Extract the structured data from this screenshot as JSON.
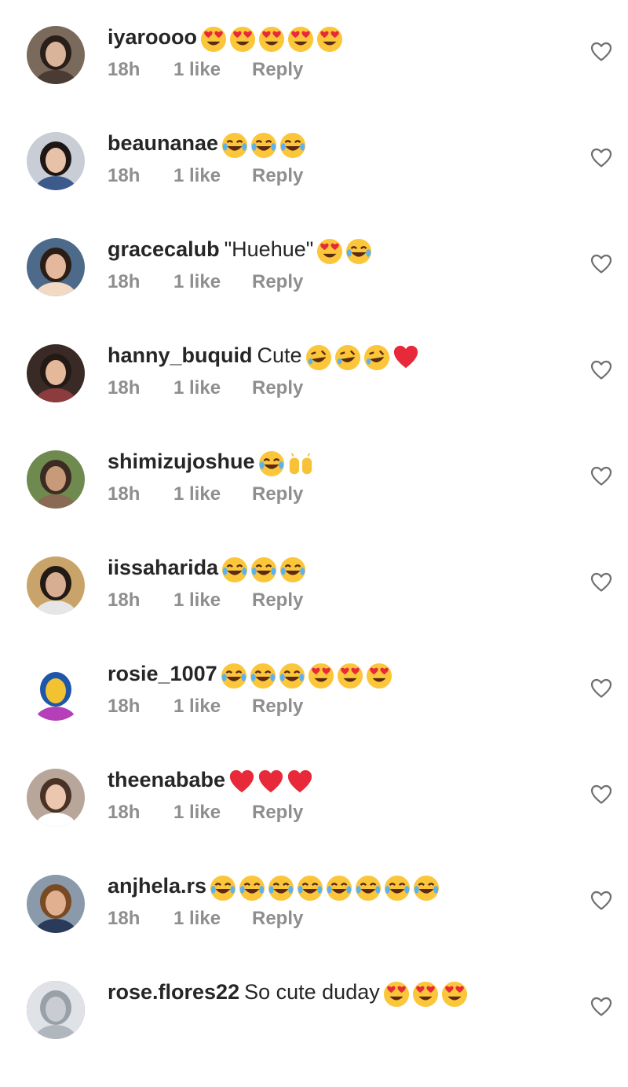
{
  "comments": [
    {
      "username": "iyaroooo",
      "text": "",
      "emojis": [
        "heart-eyes",
        "heart-eyes",
        "heart-eyes",
        "heart-eyes",
        "heart-eyes"
      ],
      "time": "18h",
      "likes": "1 like",
      "reply": "Reply",
      "avatar": {
        "bg": "#7a6a5c",
        "skin": "#d9b39a",
        "hair": "#2a1e19",
        "shirt": "#4a3b33"
      }
    },
    {
      "username": "beaunanae",
      "text": "",
      "emojis": [
        "joy",
        "joy",
        "joy"
      ],
      "time": "18h",
      "likes": "1 like",
      "reply": "Reply",
      "avatar": {
        "bg": "#c9cdd6",
        "skin": "#e8c2a8",
        "hair": "#1d1614",
        "shirt": "#3c5a8a"
      }
    },
    {
      "username": "gracecalub",
      "text": "\"Huehue\"",
      "emojis": [
        "heart-eyes",
        "joy"
      ],
      "time": "18h",
      "likes": "1 like",
      "reply": "Reply",
      "avatar": {
        "bg": "#4d6a8a",
        "skin": "#e3b89c",
        "hair": "#2b1d16",
        "shirt": "#f2d9c4"
      }
    },
    {
      "username": "hanny_buquid",
      "text": "Cute",
      "emojis": [
        "rofl",
        "rofl",
        "rofl",
        "red-heart"
      ],
      "time": "18h",
      "likes": "1 like",
      "reply": "Reply",
      "avatar": {
        "bg": "#3a2a26",
        "skin": "#e4b89a",
        "hair": "#231915",
        "shirt": "#8c3c3c"
      }
    },
    {
      "username": "shimizujoshue",
      "text": "",
      "emojis": [
        "joy",
        "raised-hands"
      ],
      "time": "18h",
      "likes": "1 like",
      "reply": "Reply",
      "avatar": {
        "bg": "#6e8a4e",
        "skin": "#c79a7a",
        "hair": "#3b2b22",
        "shirt": "#8a6a52"
      }
    },
    {
      "username": "iissaharida",
      "text": "",
      "emojis": [
        "joy",
        "joy",
        "joy"
      ],
      "time": "18h",
      "likes": "1 like",
      "reply": "Reply",
      "avatar": {
        "bg": "#c8a46a",
        "skin": "#d8ae92",
        "hair": "#231a15",
        "shirt": "#e6e6e6"
      }
    },
    {
      "username": "rosie_1007",
      "text": "",
      "emojis": [
        "joy",
        "joy",
        "joy",
        "heart-eyes",
        "heart-eyes",
        "heart-eyes"
      ],
      "time": "18h",
      "likes": "1 like",
      "reply": "Reply",
      "avatar": {
        "bg": "#ffffff",
        "skin": "#f2c230",
        "hair": "#1e56a8",
        "shirt": "#b43fb8"
      }
    },
    {
      "username": "theenababe",
      "text": "",
      "emojis": [
        "red-heart",
        "red-heart",
        "red-heart"
      ],
      "time": "18h",
      "likes": "1 like",
      "reply": "Reply",
      "avatar": {
        "bg": "#b9a69a",
        "skin": "#ecc7b0",
        "hair": "#4a3226",
        "shirt": "#ffffff"
      }
    },
    {
      "username": "anjhela.rs",
      "text": "",
      "emojis": [
        "joy",
        "joy",
        "joy",
        "joy",
        "joy",
        "joy",
        "joy",
        "joy"
      ],
      "time": "18h",
      "likes": "1 like",
      "reply": "Reply",
      "avatar": {
        "bg": "#8a9aaa",
        "skin": "#e0b090",
        "hair": "#7a4a22",
        "shirt": "#2a3a5a"
      }
    },
    {
      "username": "rose.flores22",
      "text": "So cute duday",
      "emojis": [
        "heart-eyes",
        "heart-eyes",
        "heart-eyes"
      ],
      "time": "",
      "likes": "",
      "reply": "",
      "avatar": {
        "bg": "#dfe3e8",
        "skin": "#c9ccd2",
        "hair": "#9aa0a8",
        "shirt": "#b0b6be"
      }
    }
  ]
}
